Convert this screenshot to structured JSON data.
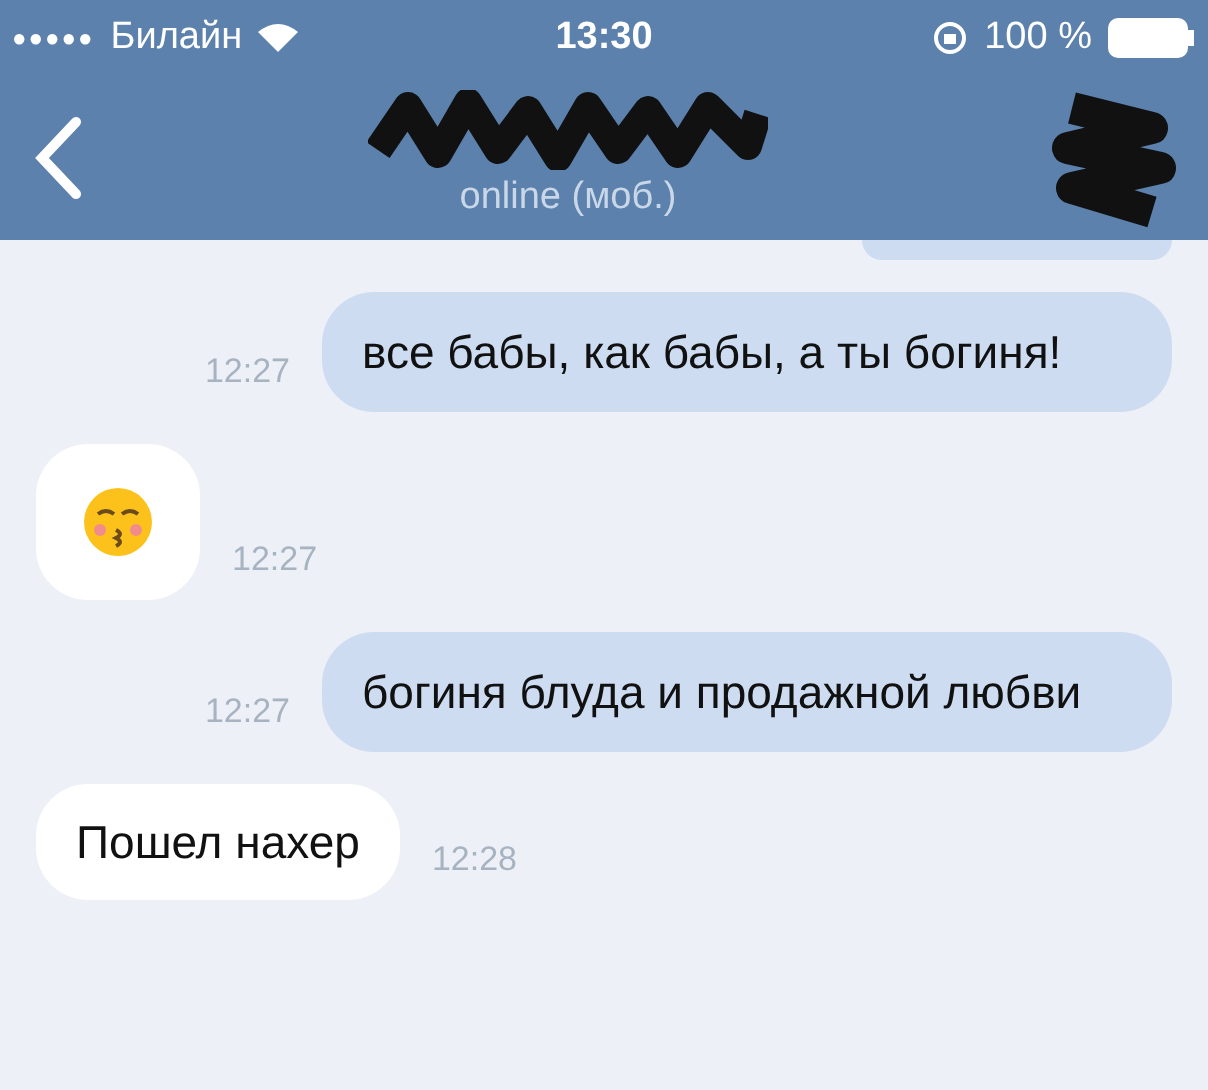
{
  "status_bar": {
    "signal_dots": "●●●●●",
    "carrier": "Билайн",
    "time": "13:30",
    "battery": "100 %"
  },
  "header": {
    "subtitle": "online (моб.)"
  },
  "messages": [
    {
      "kind": "out",
      "text": "все бабы, как бабы, а ты богиня!",
      "time": "12:27"
    },
    {
      "kind": "emoji",
      "time": "12:27"
    },
    {
      "kind": "out",
      "text": "богиня блуда и продажной любви",
      "time": "12:27"
    },
    {
      "kind": "in",
      "text": "Пошел нахер",
      "time": "12:28"
    }
  ]
}
